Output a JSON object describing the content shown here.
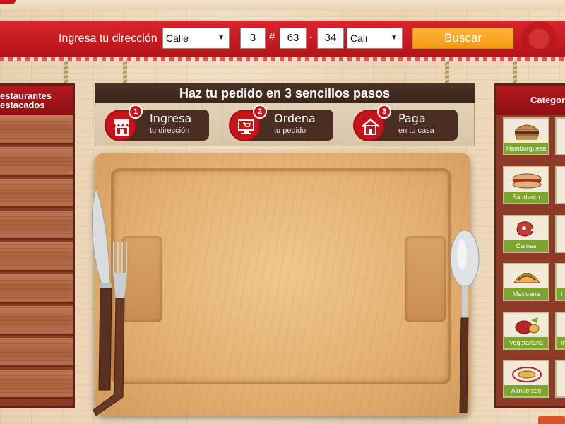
{
  "header": {
    "address_label": "Ingresa tu dirección",
    "street_type": "Calle",
    "number_1": "3",
    "hash_sep": "#",
    "number_2": "63",
    "dash_sep": "-",
    "number_3": "34",
    "city": "Cali",
    "search_button": "Buscar"
  },
  "left_panel": {
    "title_line1": "estaurantes",
    "title_line2": "estacados"
  },
  "steps": {
    "title": "Haz tu pedido en 3 sencillos pasos",
    "items": [
      {
        "num": "1",
        "label": "Ingresa",
        "sub": "tu dirección",
        "icon": "store-icon"
      },
      {
        "num": "2",
        "label": "Ordena",
        "sub": "tu pedido",
        "icon": "computer-icon"
      },
      {
        "num": "3",
        "label": "Paga",
        "sub": "en tu casa",
        "icon": "house-icon"
      }
    ]
  },
  "categories": {
    "title": "Categor",
    "items": [
      {
        "label": "Hamburguesa",
        "icon": "burger-icon"
      },
      {
        "label": "Sándwich",
        "icon": "sandwich-icon"
      },
      {
        "label": "Carnes",
        "icon": "meat-icon"
      },
      {
        "label": "Mexicana",
        "icon": "taco-icon"
      },
      {
        "label": "Vegetariana",
        "icon": "vegetable-icon"
      },
      {
        "label": "Almuerzos",
        "icon": "plate-icon"
      }
    ],
    "second_column": [
      {
        "label": "I"
      },
      {
        "label": "In"
      },
      {
        "label": ""
      }
    ]
  },
  "colors": {
    "header_red": "#c41a20",
    "button_orange": "#f39a12",
    "step_red": "#c6141a",
    "step_brown": "#4a2e22",
    "category_green": "#7ea52b",
    "wood_dark": "#8e3a28"
  }
}
